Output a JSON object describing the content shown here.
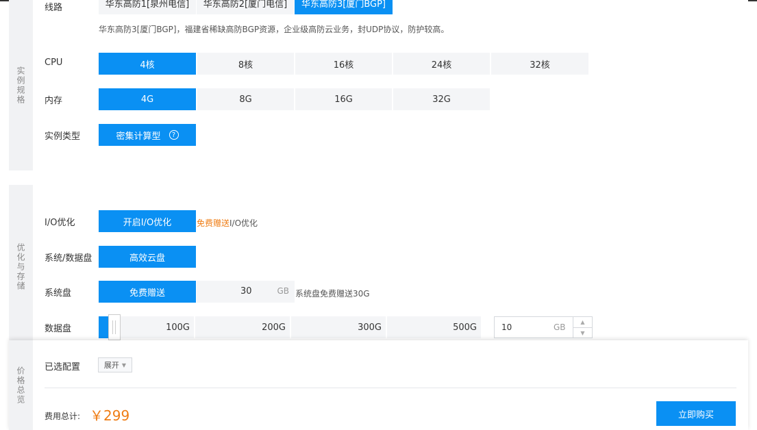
{
  "spec": {
    "side_label": "实例规格",
    "line": {
      "label": "线路",
      "options": [
        "华东高防1[泉州电信]",
        "华东高防2[厦门电信]",
        "华东高防3[厦门BGP]"
      ],
      "selected": 2,
      "description": "华东高防3[厦门BGP]，福建省稀缺高防BGP资源，企业级高防云业务，封UDP协议，防护较高。"
    },
    "cpu": {
      "label": "CPU",
      "options": [
        "4核",
        "8核",
        "16核",
        "24核",
        "32核"
      ],
      "selected": 0
    },
    "memory": {
      "label": "内存",
      "options": [
        "4G",
        "8G",
        "16G",
        "32G"
      ],
      "selected": 0
    },
    "instance_type": {
      "label": "实例类型",
      "option": "密集计算型",
      "help_icon": "question-circle-icon"
    }
  },
  "storage": {
    "side_label": "优化与存储",
    "io": {
      "label": "I/O优化",
      "option": "开启I/O优化",
      "note_highlight": "免费赠送",
      "note_rest": "I/O优化"
    },
    "disk_type": {
      "label": "系统/数据盘",
      "option": "高效云盘"
    },
    "system_disk": {
      "label": "系统盘",
      "option": "免费赠送",
      "value": "30",
      "unit": "GB",
      "note": "系统盘免费赠送30G"
    },
    "data_disk": {
      "label": "数据盘",
      "ticks": [
        "100G",
        "200G",
        "300G",
        "500G"
      ],
      "value": "10",
      "unit": "GB"
    }
  },
  "price": {
    "side_label": "价格总览",
    "selected_label": "已选配置",
    "expand_label": "展开",
    "total_label": "费用总计:",
    "total_value": "￥299",
    "buy_label": "立即购买"
  },
  "colors": {
    "accent": "#0a90f3",
    "price": "#ef7d15",
    "option_bg": "#f4f5f7",
    "side_bg": "#f1f2f4"
  }
}
